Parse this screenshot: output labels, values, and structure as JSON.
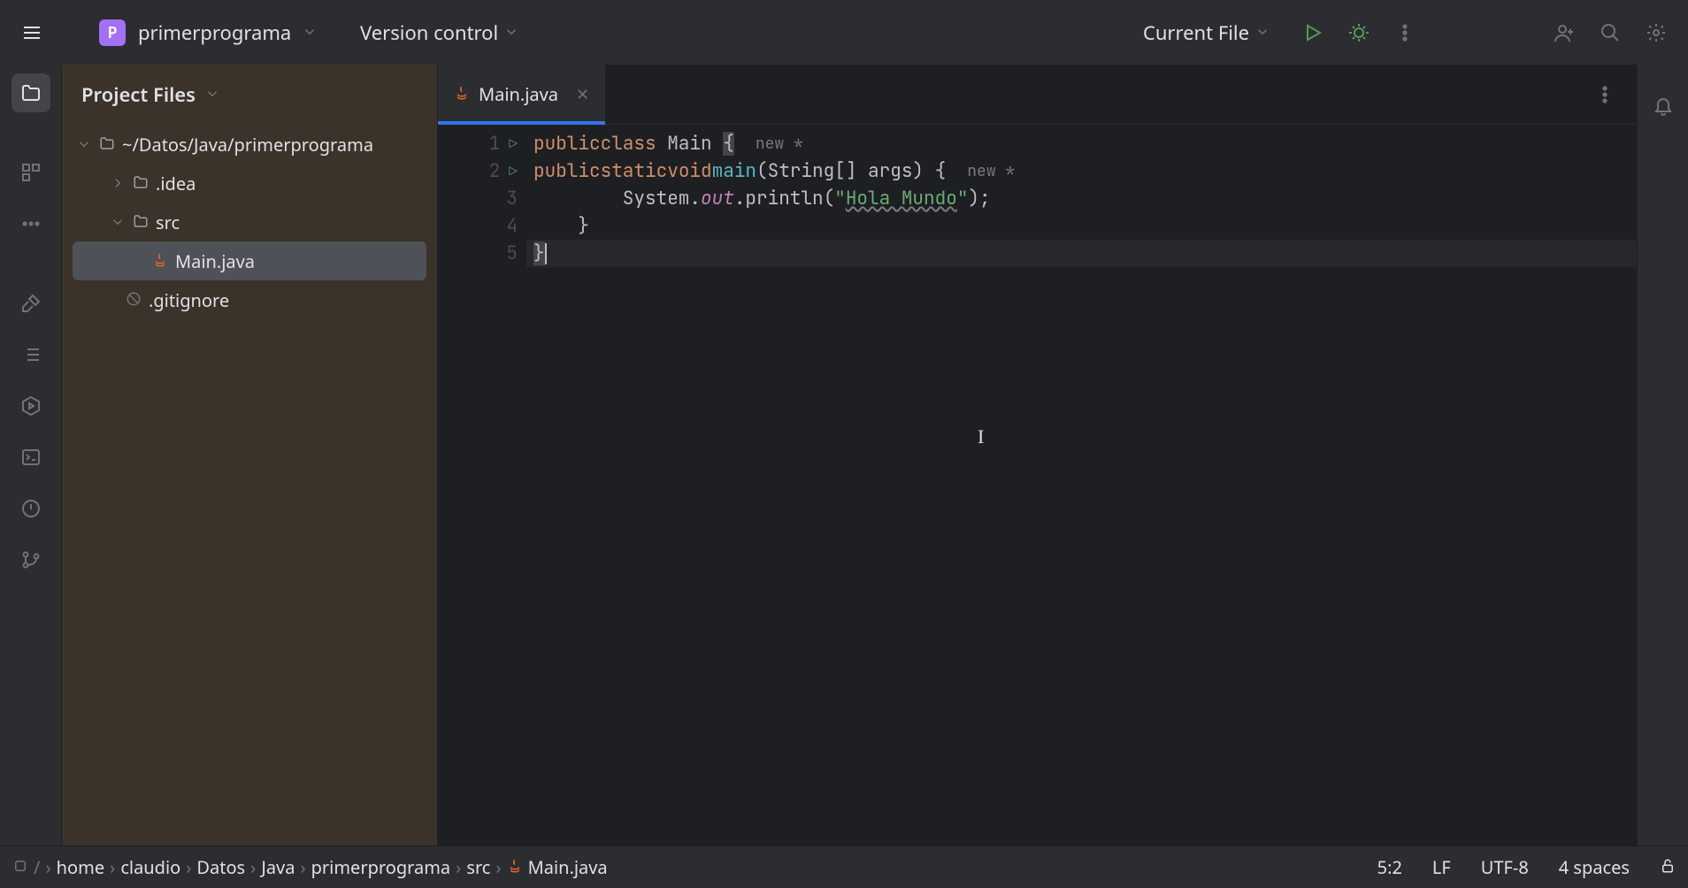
{
  "topbar": {
    "project_initial": "P",
    "project_name": "primerprograma",
    "vcs_label": "Version control",
    "run_config_label": "Current File"
  },
  "panel": {
    "title": "Project Files"
  },
  "tree": {
    "root": "~/Datos/Java/primerprograma",
    "items": [
      {
        "name": ".idea",
        "depth": 1,
        "expandable": true,
        "expanded": false,
        "icon": "folder"
      },
      {
        "name": "src",
        "depth": 1,
        "expandable": true,
        "expanded": true,
        "icon": "folder"
      },
      {
        "name": "Main.java",
        "depth": 2,
        "expandable": false,
        "icon": "java",
        "selected": true
      },
      {
        "name": ".gitignore",
        "depth": 1,
        "expandable": false,
        "icon": "gitignore"
      }
    ]
  },
  "tabs": {
    "active": "Main.java"
  },
  "code": {
    "inlay_new": "new *",
    "lines": [
      {
        "n": 1,
        "runnable": true,
        "text": "public class Main {",
        "inlay": true
      },
      {
        "n": 2,
        "runnable": true,
        "text": "    public static void main(String[] args) {",
        "inlay": true
      },
      {
        "n": 3,
        "runnable": false,
        "text": "        System.out.println(\"Hola Mundo\");"
      },
      {
        "n": 4,
        "runnable": false,
        "text": "    }"
      },
      {
        "n": 5,
        "runnable": false,
        "text": "}",
        "current": true
      }
    ],
    "string_literal": "Hola Mundo"
  },
  "breadcrumbs": [
    "home",
    "claudio",
    "Datos",
    "Java",
    "primerprograma",
    "src",
    "Main.java"
  ],
  "status": {
    "cursor": "5:2",
    "line_sep": "LF",
    "encoding": "UTF-8",
    "indent": "4 spaces"
  }
}
